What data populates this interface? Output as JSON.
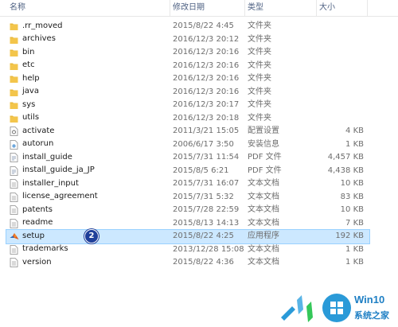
{
  "columns": {
    "name": "名称",
    "date": "修改日期",
    "type": "类型",
    "size": "大小"
  },
  "files": [
    {
      "name": ".rr_moved",
      "date": "2015/8/22 4:45",
      "type": "文件夹",
      "size": "",
      "icon": "folder-icon"
    },
    {
      "name": "archives",
      "date": "2016/12/3 20:12",
      "type": "文件夹",
      "size": "",
      "icon": "folder-icon"
    },
    {
      "name": "bin",
      "date": "2016/12/3 20:16",
      "type": "文件夹",
      "size": "",
      "icon": "folder-icon"
    },
    {
      "name": "etc",
      "date": "2016/12/3 20:16",
      "type": "文件夹",
      "size": "",
      "icon": "folder-icon"
    },
    {
      "name": "help",
      "date": "2016/12/3 20:16",
      "type": "文件夹",
      "size": "",
      "icon": "folder-icon"
    },
    {
      "name": "java",
      "date": "2016/12/3 20:16",
      "type": "文件夹",
      "size": "",
      "icon": "folder-icon"
    },
    {
      "name": "sys",
      "date": "2016/12/3 20:17",
      "type": "文件夹",
      "size": "",
      "icon": "folder-icon"
    },
    {
      "name": "utils",
      "date": "2016/12/3 20:18",
      "type": "文件夹",
      "size": "",
      "icon": "folder-icon"
    },
    {
      "name": "activate",
      "date": "2011/3/21 15:05",
      "type": "配置设置",
      "size": "4 KB",
      "icon": "settings-file-icon"
    },
    {
      "name": "autorun",
      "date": "2006/6/17 3:50",
      "type": "安装信息",
      "size": "1 KB",
      "icon": "setup-info-file-icon"
    },
    {
      "name": "install_guide",
      "date": "2015/7/31 11:54",
      "type": "PDF 文件",
      "size": "4,457 KB",
      "icon": "pdf-file-icon"
    },
    {
      "name": "install_guide_ja_JP",
      "date": "2015/8/5 6:21",
      "type": "PDF 文件",
      "size": "4,438 KB",
      "icon": "pdf-file-icon"
    },
    {
      "name": "installer_input",
      "date": "2015/7/31 16:07",
      "type": "文本文档",
      "size": "10 KB",
      "icon": "text-file-icon"
    },
    {
      "name": "license_agreement",
      "date": "2015/7/31 5:32",
      "type": "文本文档",
      "size": "83 KB",
      "icon": "text-file-icon"
    },
    {
      "name": "patents",
      "date": "2015/7/28 22:59",
      "type": "文本文档",
      "size": "10 KB",
      "icon": "text-file-icon"
    },
    {
      "name": "readme",
      "date": "2015/8/13 14:13",
      "type": "文本文档",
      "size": "7 KB",
      "icon": "text-file-icon"
    },
    {
      "name": "setup",
      "date": "2015/8/22 4:25",
      "type": "应用程序",
      "size": "192 KB",
      "icon": "matlab-app-icon",
      "selected": true
    },
    {
      "name": "trademarks",
      "date": "2013/12/28 15:08",
      "type": "文本文档",
      "size": "1 KB",
      "icon": "text-file-icon"
    },
    {
      "name": "version",
      "date": "2015/8/22 4:36",
      "type": "文本文档",
      "size": "1 KB",
      "icon": "text-file-icon"
    }
  ],
  "step_badge": "2",
  "watermark": {
    "brand": "Win10",
    "site": "系统之家"
  },
  "colors": {
    "folder": "#f3c54b",
    "selection": "#cce8ff",
    "selection_border": "#99d1ff",
    "header_text": "#4d6082",
    "badge": "#1f3f9a",
    "watermark": "#1e7fc4"
  }
}
